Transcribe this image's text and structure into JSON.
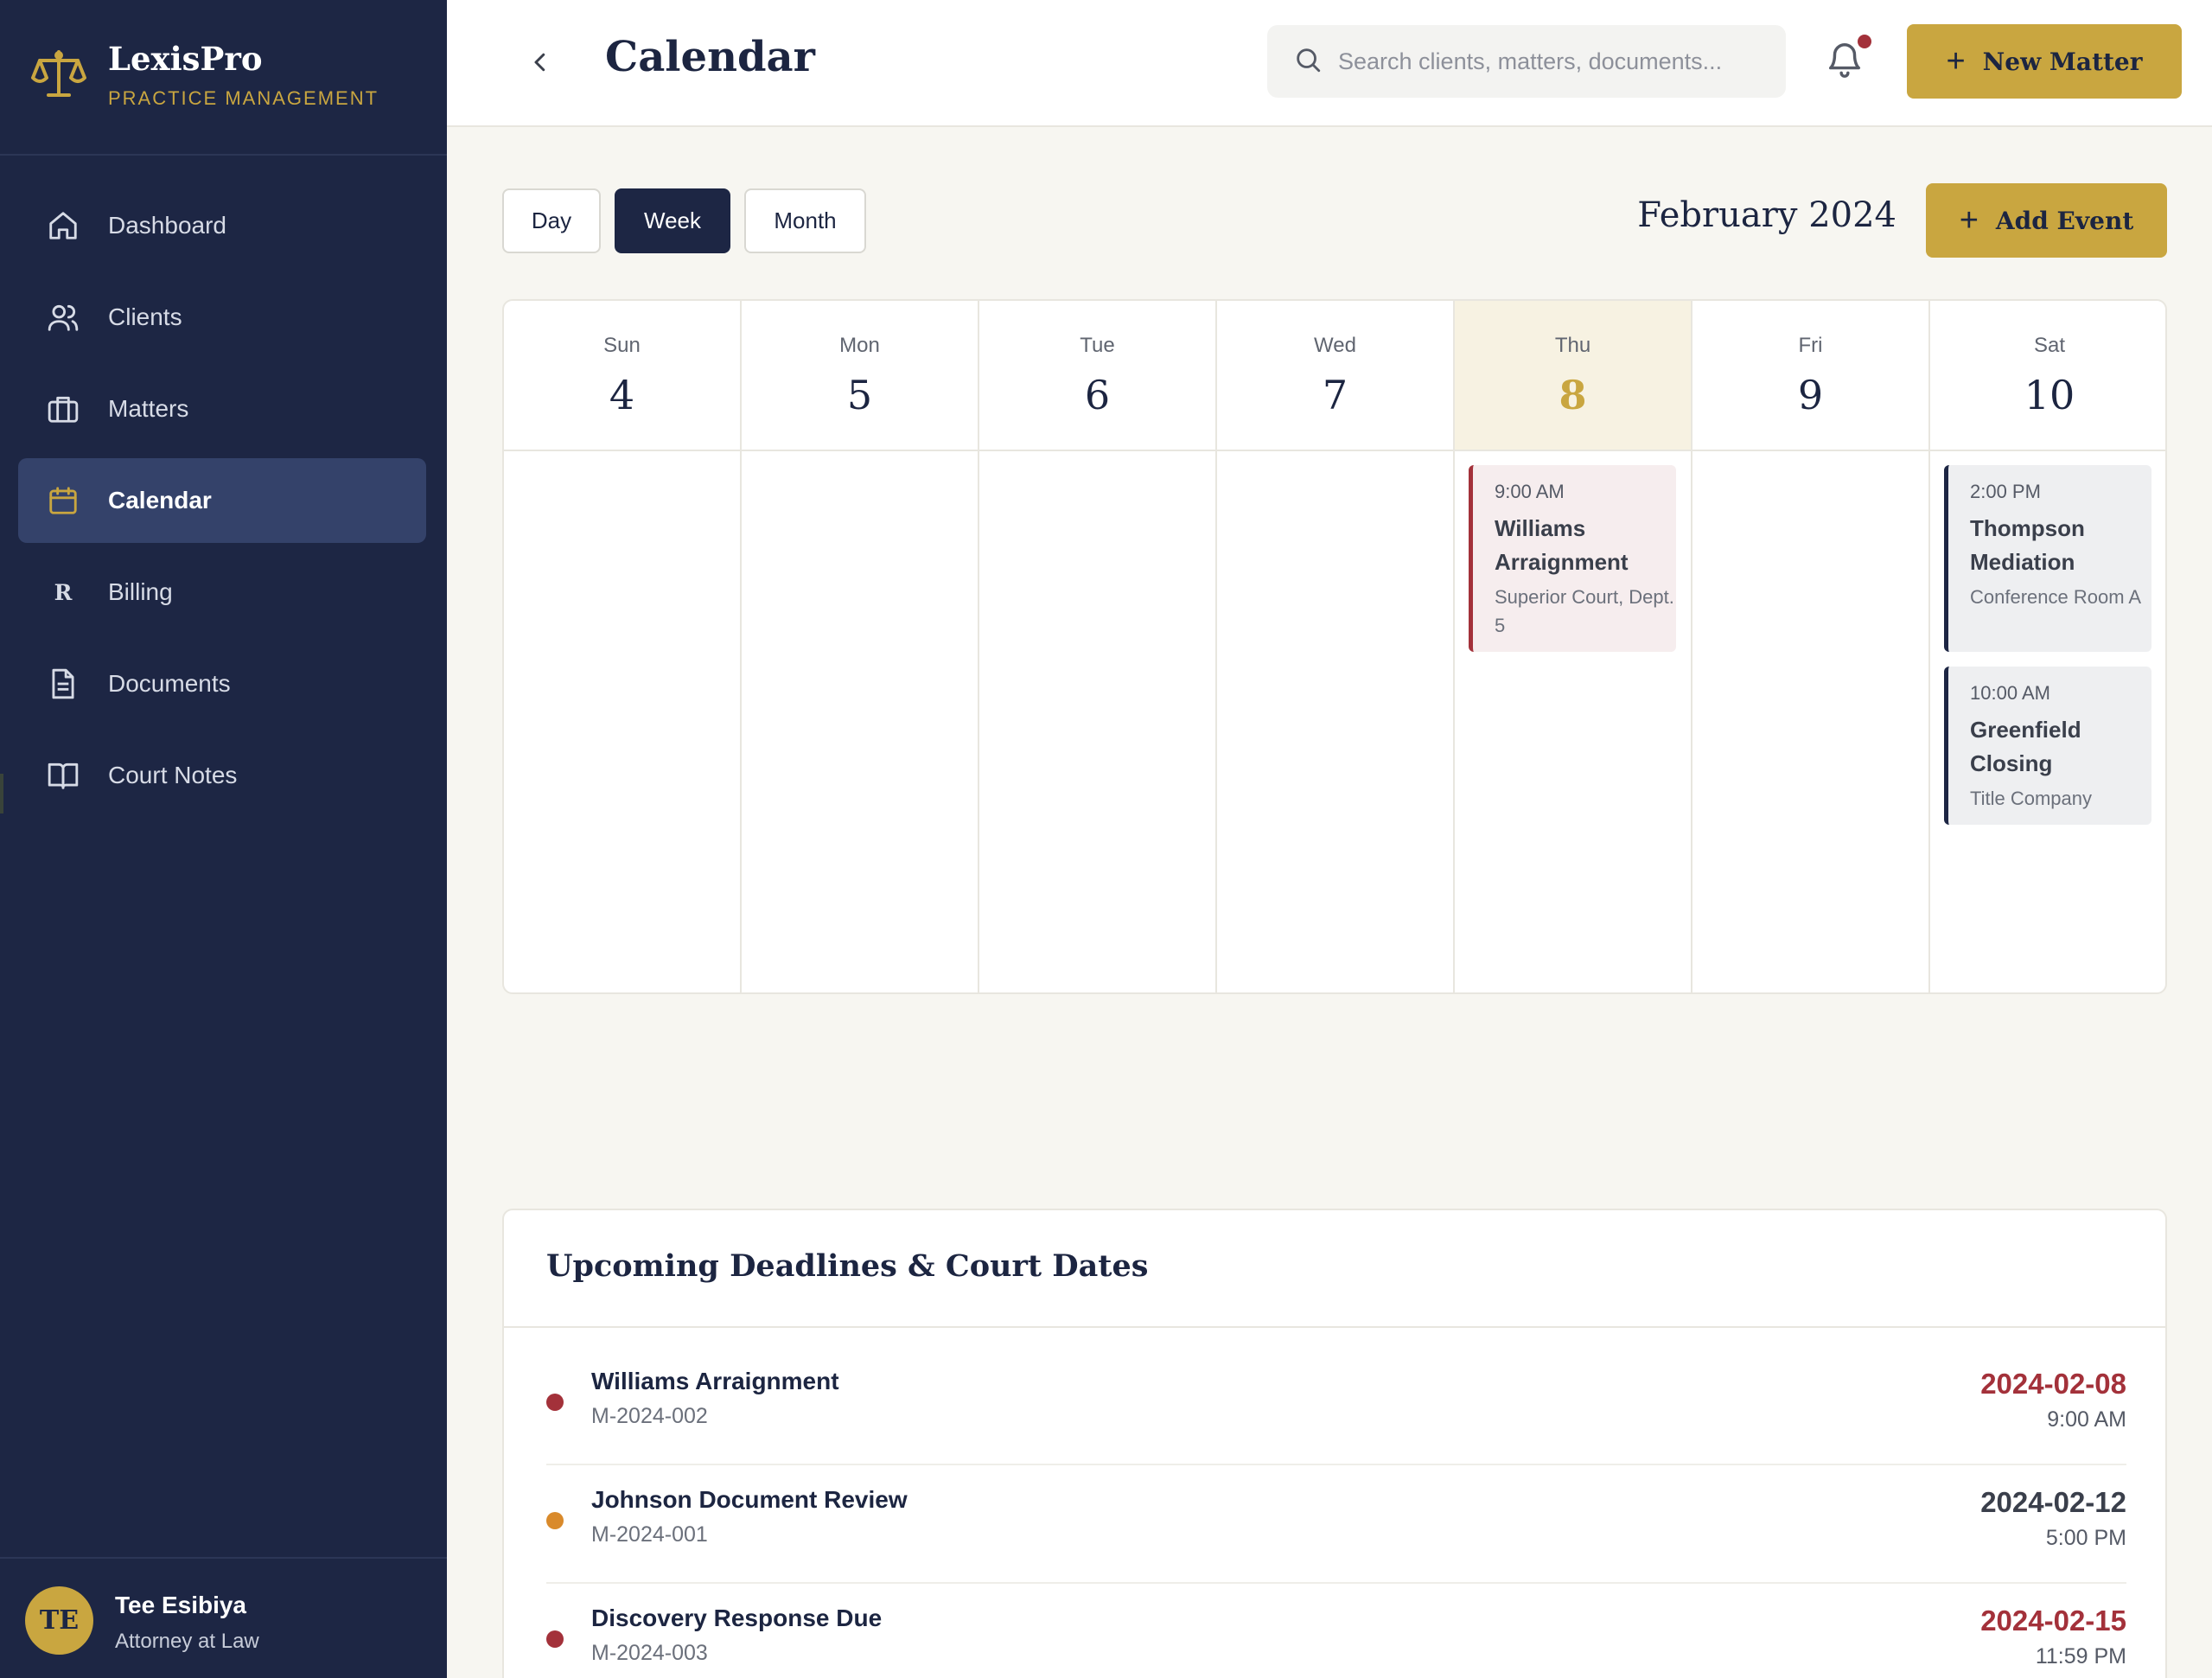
{
  "app": {
    "name": "LexisPro",
    "subtitle": "PRACTICE MANAGEMENT"
  },
  "sidebar": {
    "items": [
      {
        "label": "Dashboard",
        "icon": "home-icon"
      },
      {
        "label": "Clients",
        "icon": "users-icon"
      },
      {
        "label": "Matters",
        "icon": "briefcase-icon"
      },
      {
        "label": "Calendar",
        "icon": "calendar-icon",
        "active": true
      },
      {
        "label": "Billing",
        "icon": "billing-r-icon",
        "glyph": "R"
      },
      {
        "label": "Documents",
        "icon": "document-icon"
      },
      {
        "label": "Court Notes",
        "icon": "book-icon"
      }
    ]
  },
  "user": {
    "initials": "TE",
    "name": "Tee Esibiya",
    "role": "Attorney at Law"
  },
  "header": {
    "title": "Calendar",
    "search_placeholder": "Search clients, matters, documents...",
    "new_matter_label": "New Matter"
  },
  "toolbar": {
    "views": [
      "Day",
      "Week",
      "Month"
    ],
    "active_view": "Week",
    "month_label": "February 2024",
    "add_event_label": "Add Event"
  },
  "calendar": {
    "days": [
      {
        "name": "Sun",
        "num": "4"
      },
      {
        "name": "Mon",
        "num": "5"
      },
      {
        "name": "Tue",
        "num": "6"
      },
      {
        "name": "Wed",
        "num": "7"
      },
      {
        "name": "Thu",
        "num": "8",
        "today": true
      },
      {
        "name": "Fri",
        "num": "9"
      },
      {
        "name": "Sat",
        "num": "10"
      }
    ],
    "events": {
      "thu": [
        {
          "time": "9:00 AM",
          "title": "Williams Arraignment",
          "location": "Superior Court, Dept. 5"
        }
      ],
      "sat": [
        {
          "time": "2:00 PM",
          "title": "Thompson Mediation",
          "location": "Conference Room A"
        },
        {
          "time": "10:00 AM",
          "title": "Greenfield Closing",
          "location": "Title Company"
        }
      ]
    }
  },
  "deadlines": {
    "title": "Upcoming Deadlines & Court Dates",
    "items": [
      {
        "name": "Williams Arraignment",
        "matter": "M-2024-002",
        "date": "2024-02-08",
        "time": "9:00 AM"
      },
      {
        "name": "Johnson Document Review",
        "matter": "M-2024-001",
        "date": "2024-02-12",
        "time": "5:00 PM"
      },
      {
        "name": "Discovery Response Due",
        "matter": "M-2024-003",
        "date": "2024-02-15",
        "time": "11:59 PM"
      }
    ]
  },
  "colors": {
    "navy": "#1d2644",
    "gold": "#c9a640",
    "urgent_red": "#a3313a",
    "warning_orange": "#d98a2b",
    "background": "#f7f6f1"
  }
}
